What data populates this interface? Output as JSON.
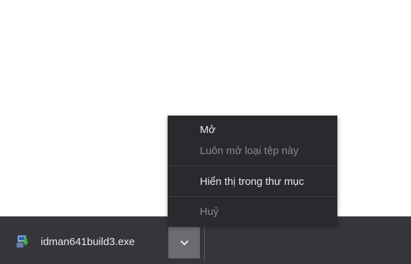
{
  "context_menu": {
    "items": [
      {
        "label": "Mở",
        "enabled": true
      },
      {
        "label": "Luôn mở loại tệp này",
        "enabled": false
      },
      {
        "label": "Hiển thị trong thư mục",
        "enabled": true
      },
      {
        "label": "Huỷ",
        "enabled": false
      }
    ]
  },
  "download_shelf": {
    "file_name": "idman641build3.exe",
    "file_icon": "idm-installer-icon",
    "dropdown_icon": "chevron-down-icon"
  },
  "colors": {
    "menu_background": "#292a2d",
    "shelf_background": "#35363a",
    "button_background": "#6b6c70",
    "text": "#e8eaed",
    "disabled_text": "#8a8b8e"
  }
}
